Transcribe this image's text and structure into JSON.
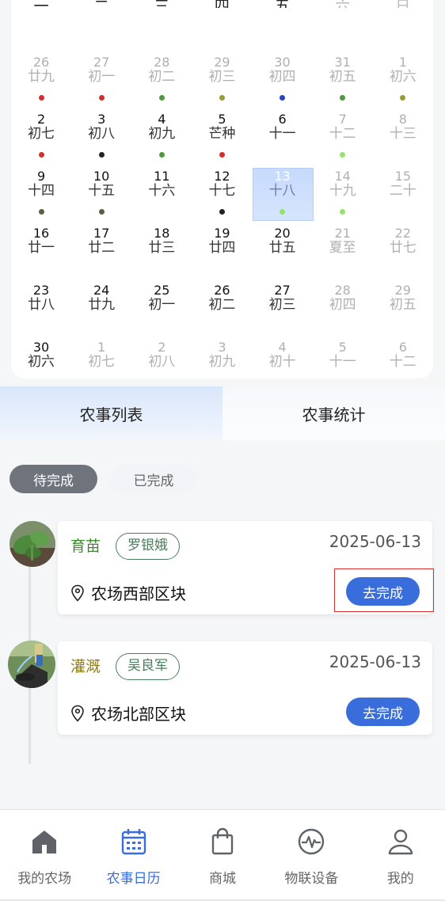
{
  "calendar": {
    "weekdays": [
      {
        "label": "一",
        "dim": false
      },
      {
        "label": "二",
        "dim": false
      },
      {
        "label": "三",
        "dim": false
      },
      {
        "label": "四",
        "dim": false
      },
      {
        "label": "五",
        "dim": false
      },
      {
        "label": "六",
        "dim": true
      },
      {
        "label": "日",
        "dim": true
      }
    ],
    "weeks": [
      [
        {
          "num": "26",
          "lunar": "廿九",
          "other": true,
          "dot": "#d4302a"
        },
        {
          "num": "27",
          "lunar": "初一",
          "other": true,
          "dot": "#d4302a"
        },
        {
          "num": "28",
          "lunar": "初二",
          "other": true,
          "dot": "#4c9a3a"
        },
        {
          "num": "29",
          "lunar": "初三",
          "other": true,
          "dot": "#9c9a33"
        },
        {
          "num": "30",
          "lunar": "初四",
          "other": true,
          "dot": "#2545c9"
        },
        {
          "num": "31",
          "lunar": "初五",
          "other": true,
          "dot": "#4c9a3a"
        },
        {
          "num": "1",
          "lunar": "初六",
          "other": true,
          "dot": "#9c9a33"
        }
      ],
      [
        {
          "num": "2",
          "lunar": "初七",
          "other": false,
          "dot": "#d4302a"
        },
        {
          "num": "3",
          "lunar": "初八",
          "other": false,
          "dot": "#222222"
        },
        {
          "num": "4",
          "lunar": "初九",
          "other": false,
          "dot": "#4c9a3a"
        },
        {
          "num": "5",
          "lunar": "芒种",
          "other": false,
          "dot": "#d4302a"
        },
        {
          "num": "6",
          "lunar": "十一",
          "other": false,
          "dot": ""
        },
        {
          "num": "7",
          "lunar": "十二",
          "other": true,
          "dot": "#8fe66b"
        },
        {
          "num": "8",
          "lunar": "十三",
          "other": true,
          "dot": ""
        }
      ],
      [
        {
          "num": "9",
          "lunar": "十四",
          "other": false,
          "dot": "#5b5e46"
        },
        {
          "num": "10",
          "lunar": "十五",
          "other": false,
          "dot": "#5b5e46"
        },
        {
          "num": "11",
          "lunar": "十六",
          "other": false,
          "dot": ""
        },
        {
          "num": "12",
          "lunar": "十七",
          "other": false,
          "dot": "#222222"
        },
        {
          "num": "13",
          "lunar": "十八",
          "other": false,
          "dot": "#8fe66b",
          "selected": true
        },
        {
          "num": "14",
          "lunar": "十九",
          "other": true,
          "dot": "#8fe66b"
        },
        {
          "num": "15",
          "lunar": "二十",
          "other": true,
          "dot": ""
        }
      ],
      [
        {
          "num": "16",
          "lunar": "廿一",
          "other": false,
          "dot": ""
        },
        {
          "num": "17",
          "lunar": "廿二",
          "other": false,
          "dot": ""
        },
        {
          "num": "18",
          "lunar": "廿三",
          "other": false,
          "dot": ""
        },
        {
          "num": "19",
          "lunar": "廿四",
          "other": false,
          "dot": ""
        },
        {
          "num": "20",
          "lunar": "廿五",
          "other": false,
          "dot": ""
        },
        {
          "num": "21",
          "lunar": "夏至",
          "other": true,
          "dot": ""
        },
        {
          "num": "22",
          "lunar": "廿七",
          "other": true,
          "dot": ""
        }
      ],
      [
        {
          "num": "23",
          "lunar": "廿八",
          "other": false,
          "dot": ""
        },
        {
          "num": "24",
          "lunar": "廿九",
          "other": false,
          "dot": ""
        },
        {
          "num": "25",
          "lunar": "初一",
          "other": false,
          "dot": ""
        },
        {
          "num": "26",
          "lunar": "初二",
          "other": false,
          "dot": ""
        },
        {
          "num": "27",
          "lunar": "初三",
          "other": false,
          "dot": ""
        },
        {
          "num": "28",
          "lunar": "初四",
          "other": true,
          "dot": ""
        },
        {
          "num": "29",
          "lunar": "初五",
          "other": true,
          "dot": ""
        }
      ],
      [
        {
          "num": "30",
          "lunar": "初六",
          "other": false,
          "dot": ""
        },
        {
          "num": "1",
          "lunar": "初七",
          "other": true,
          "dot": ""
        },
        {
          "num": "2",
          "lunar": "初八",
          "other": true,
          "dot": ""
        },
        {
          "num": "3",
          "lunar": "初九",
          "other": true,
          "dot": ""
        },
        {
          "num": "4",
          "lunar": "初十",
          "other": true,
          "dot": ""
        },
        {
          "num": "5",
          "lunar": "十一",
          "other": true,
          "dot": ""
        },
        {
          "num": "6",
          "lunar": "十二",
          "other": true,
          "dot": ""
        }
      ]
    ]
  },
  "tabs": {
    "list": "农事列表",
    "stats": "农事统计"
  },
  "filters": {
    "pending": "待完成",
    "completed": "已完成"
  },
  "tasks": [
    {
      "title": "育苗",
      "title_color": "#3c8a2e",
      "assignee": "罗银娥",
      "date": "2025-06-13",
      "location": "农场西部区块",
      "action": "去完成"
    },
    {
      "title": "灌溉",
      "title_color": "#8c7a16",
      "assignee": "吴良军",
      "date": "2025-06-13",
      "location": "农场北部区块",
      "action": "去完成"
    }
  ],
  "nav": {
    "items": [
      {
        "label": "我的农场",
        "icon": "home-icon",
        "active": false
      },
      {
        "label": "农事日历",
        "icon": "calendar-icon",
        "active": true
      },
      {
        "label": "商城",
        "icon": "shopping-bag-icon",
        "active": false
      },
      {
        "label": "物联设备",
        "icon": "pulse-icon",
        "active": false
      },
      {
        "label": "我的",
        "icon": "user-icon",
        "active": false
      }
    ]
  },
  "colors": {
    "accent": "#3a6ddc",
    "highlight": "#d9302e"
  }
}
